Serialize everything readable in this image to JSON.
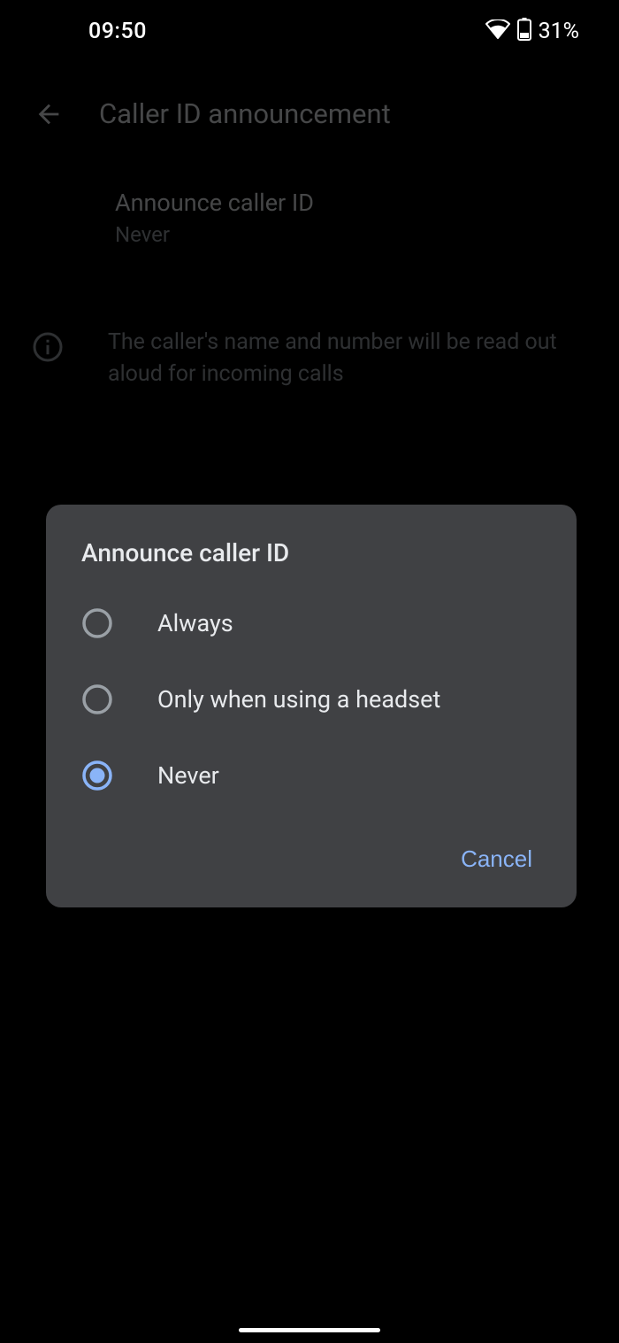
{
  "status": {
    "time": "09:50",
    "battery_percent": "31%"
  },
  "header": {
    "title": "Caller ID announcement"
  },
  "setting": {
    "title": "Announce caller ID",
    "value": "Never"
  },
  "info": {
    "text": "The caller's name and number will be read out aloud for incoming calls"
  },
  "dialog": {
    "title": "Announce caller ID",
    "options": {
      "0": {
        "label": "Always",
        "selected": false
      },
      "1": {
        "label": "Only when using a headset",
        "selected": false
      },
      "2": {
        "label": "Never",
        "selected": true
      }
    },
    "cancel_label": "Cancel"
  },
  "colors": {
    "accent": "#8ab4f8"
  }
}
